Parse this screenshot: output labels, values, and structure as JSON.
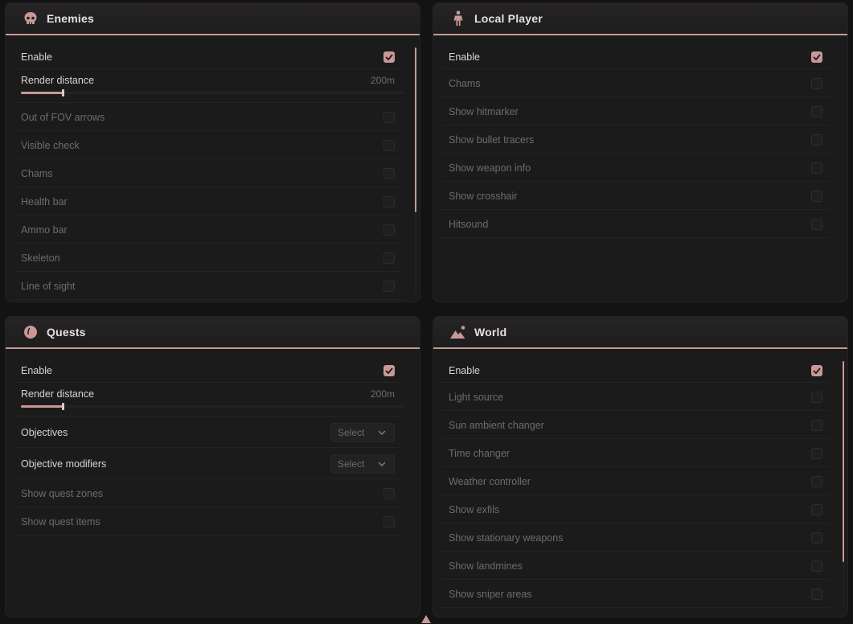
{
  "accent": "#c99896",
  "enemies": {
    "title": "Enemies",
    "icon": "skull-icon",
    "enable_label": "Enable",
    "enable_checked": true,
    "render_distance": {
      "label": "Render distance",
      "value": "200m",
      "fraction": 0.11
    },
    "options": [
      {
        "label": "Out of FOV arrows",
        "checked": false
      },
      {
        "label": "Visible check",
        "checked": false
      },
      {
        "label": "Chams",
        "checked": false
      },
      {
        "label": "Health bar",
        "checked": false
      },
      {
        "label": "Ammo bar",
        "checked": false
      },
      {
        "label": "Skeleton",
        "checked": false
      },
      {
        "label": "Line of sight",
        "checked": false
      }
    ]
  },
  "local_player": {
    "title": "Local Player",
    "icon": "person-icon",
    "enable_label": "Enable",
    "enable_checked": true,
    "options": [
      {
        "label": "Chams",
        "checked": false
      },
      {
        "label": "Show hitmarker",
        "checked": false
      },
      {
        "label": "Show bullet tracers",
        "checked": false
      },
      {
        "label": "Show weapon info",
        "checked": false
      },
      {
        "label": "Show crosshair",
        "checked": false
      },
      {
        "label": "Hitsound",
        "checked": false
      }
    ]
  },
  "quests": {
    "title": "Quests",
    "icon": "egg-icon",
    "enable_label": "Enable",
    "enable_checked": true,
    "render_distance": {
      "label": "Render distance",
      "value": "200m",
      "fraction": 0.11
    },
    "objectives": {
      "label": "Objectives",
      "select": "Select"
    },
    "objective_modifiers": {
      "label": "Objective modifiers",
      "select": "Select"
    },
    "options": [
      {
        "label": "Show quest zones",
        "checked": false
      },
      {
        "label": "Show quest items",
        "checked": false
      }
    ]
  },
  "world": {
    "title": "World",
    "icon": "mountain-icon",
    "enable_label": "Enable",
    "enable_checked": true,
    "options": [
      {
        "label": "Light source",
        "checked": false
      },
      {
        "label": "Sun ambient changer",
        "checked": false
      },
      {
        "label": "Time changer",
        "checked": false
      },
      {
        "label": "Weather controller",
        "checked": false
      },
      {
        "label": "Show exfils",
        "checked": false
      },
      {
        "label": "Show stationary weapons",
        "checked": false
      },
      {
        "label": "Show landmines",
        "checked": false
      },
      {
        "label": "Show sniper areas",
        "checked": false
      }
    ]
  }
}
